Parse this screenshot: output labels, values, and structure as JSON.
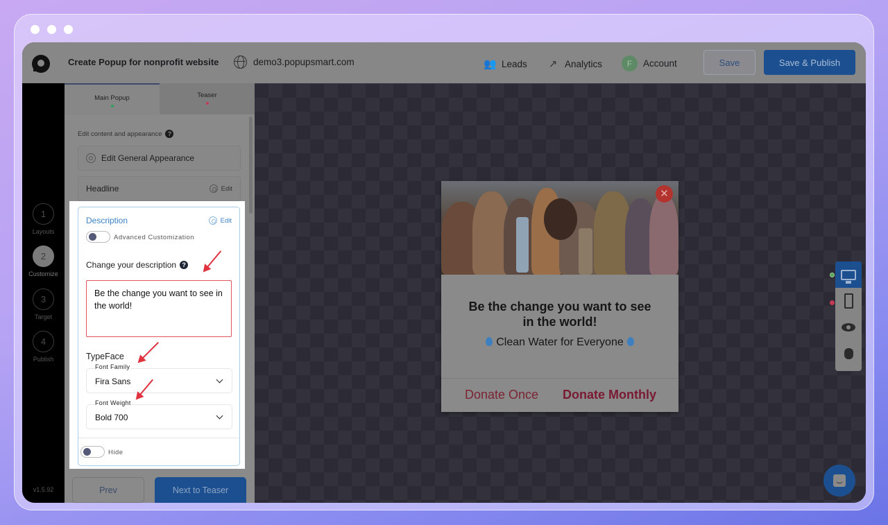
{
  "window": {
    "controls": [
      "close",
      "minimize",
      "maximize"
    ]
  },
  "topbar": {
    "project_title": "Create Popup for nonprofit website",
    "domain": "demo3.popupsmart.com",
    "nav": [
      {
        "label": "Leads",
        "icon": "users-icon"
      },
      {
        "label": "Analytics",
        "icon": "trend-icon"
      },
      {
        "label": "Account",
        "icon": "avatar",
        "avatar_letter": "F"
      }
    ],
    "save_label": "Save",
    "publish_label": "Save & Publish"
  },
  "steps": [
    {
      "number": "1",
      "label": "Layouts",
      "active": false
    },
    {
      "number": "2",
      "label": "Customize",
      "active": true
    },
    {
      "number": "3",
      "label": "Target",
      "active": false
    },
    {
      "number": "4",
      "label": "Publish",
      "active": false
    }
  ],
  "version": "v1.5.92",
  "panel": {
    "tabs": [
      {
        "label": "Main Popup",
        "status_color": "#2e9e5a",
        "active": true
      },
      {
        "label": "Teaser",
        "status_color": "#c43a55",
        "active": false
      }
    ],
    "section_hint": "Edit content and appearance",
    "general_appearance_label": "Edit General Appearance",
    "headline": {
      "label": "Headline",
      "edit_label": "Edit"
    },
    "description": {
      "title": "Description",
      "edit_label": "Edit",
      "advanced_toggle_label": "Advanced Customization",
      "advanced_toggle_on": false,
      "field_label": "Change your description",
      "value": "Be the change you want to see in the world!",
      "typeface_label": "TypeFace",
      "font_family": {
        "label": "Font Family",
        "value": "Fira Sans"
      },
      "font_weight": {
        "label": "Font Weight",
        "value": "Bold 700"
      },
      "hide_toggle_label": "Hide",
      "hide_toggle_on": false
    },
    "prev_label": "Prev",
    "next_label": "Next to Teaser"
  },
  "popup": {
    "close_glyph": "✕",
    "headline": "Be the change you want to see in the world!",
    "subtext": "Clean Water for Everyone",
    "donate_once_label": "Donate Once",
    "donate_monthly_label": "Donate Monthly"
  },
  "device_bar": [
    {
      "name": "desktop",
      "active": true,
      "status_color": "#5ba35b"
    },
    {
      "name": "mobile",
      "active": false,
      "status_color": "#c43a55"
    },
    {
      "name": "preview",
      "active": false
    },
    {
      "name": "debug",
      "active": false
    }
  ]
}
